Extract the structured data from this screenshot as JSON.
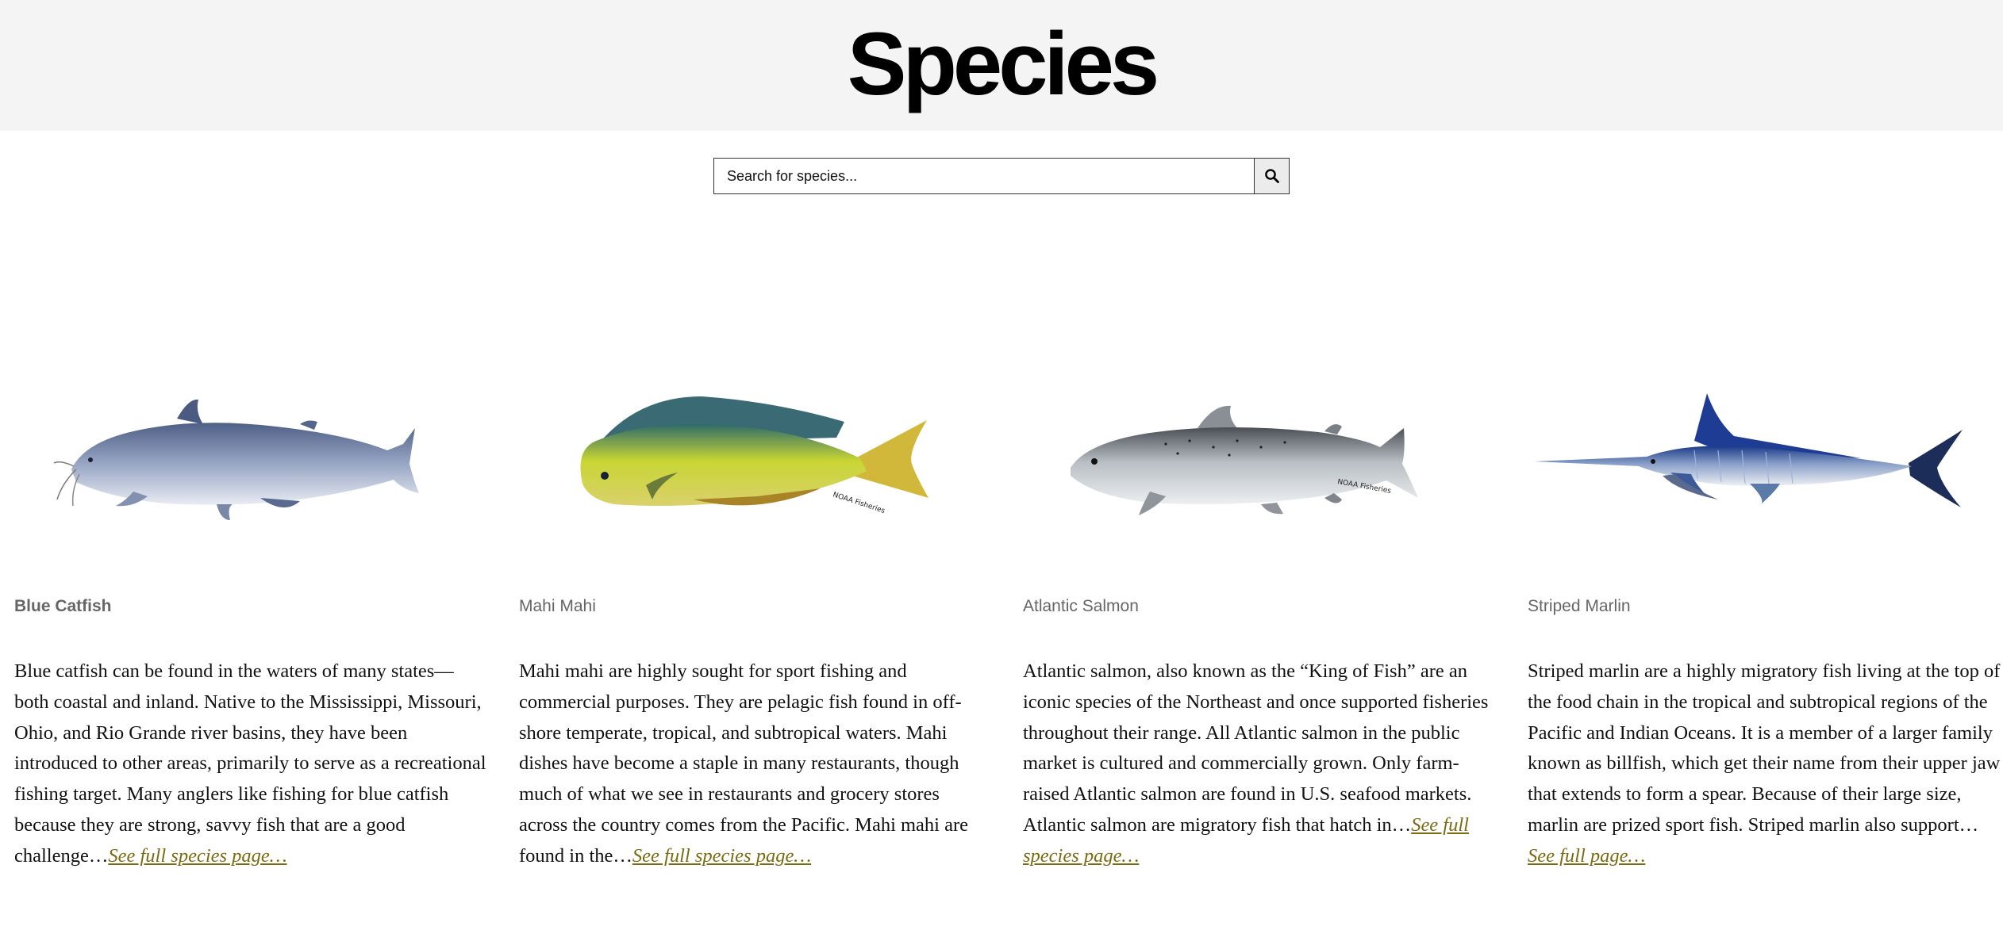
{
  "header": {
    "title": "Species"
  },
  "search": {
    "placeholder": "Search for species..."
  },
  "species": [
    {
      "name": "Blue Catfish",
      "description": "Blue catfish can be found in the waters of many states—both coastal and inland. Native to the Mississippi, Missouri, Ohio, and Rio Grande river basins, they have been introduced to other areas, primarily to serve as a recreational fishing target. Many anglers like fishing for blue catfish because they are strong, savvy fish that are a good challenge…",
      "link": "See full species page…"
    },
    {
      "name": "Mahi Mahi",
      "description": "Mahi mahi are highly sought for sport fishing and commercial purposes. They are pelagic fish found in off-shore temperate, tropical, and subtropical waters. Mahi dishes have become a staple in many restaurants, though much of what we see in restaurants and grocery stores across the country comes from the Pacific. Mahi mahi are found in the…",
      "link": "See full species page…"
    },
    {
      "name": "Atlantic Salmon",
      "description": "Atlantic salmon, also known as the “King of Fish” are an iconic species of the Northeast and once supported fisheries throughout their range. All Atlantic salmon in the public market is cultured and commercially grown. Only farm-raised Atlantic salmon are found in U.S. seafood markets. Atlantic salmon are migratory fish that hatch in…",
      "link": "See full species page…"
    },
    {
      "name": "Striped Marlin",
      "description": "Striped marlin are a highly migratory fish living at the top of the food chain in the tropical and subtropical regions of the Pacific and Indian Oceans. It is a member of a larger family known as billfish, which get their name from their upper jaw that extends to form a spear. Because of their large size, marlin are prized sport fish. Striped marlin also support…",
      "link": "See full page…"
    }
  ],
  "colors": {
    "header_bg": "#f4f4f4",
    "link": "#7a6a10",
    "name": "#666666"
  },
  "icons": {
    "search_button": "search-icon"
  }
}
